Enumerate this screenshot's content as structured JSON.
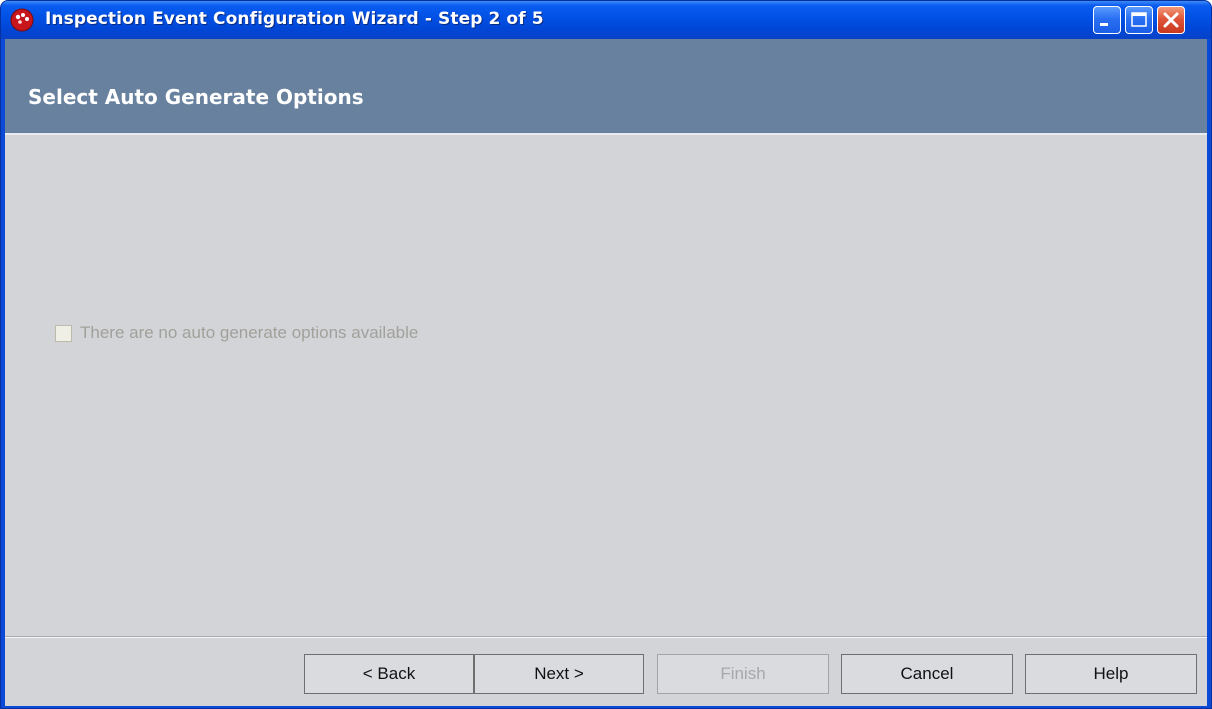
{
  "window": {
    "title": "Inspection Event Configuration Wizard - Step 2 of 5"
  },
  "header": {
    "title": "Select Auto Generate Options"
  },
  "options": {
    "checkbox_label": "There are no auto generate options available",
    "checked": false,
    "enabled": false
  },
  "buttons": {
    "back": "< Back",
    "next": "Next >",
    "finish": "Finish",
    "cancel": "Cancel",
    "help": "Help"
  },
  "icons": {
    "app": "app-icon",
    "minimize": "minimize-icon",
    "maximize": "maximize-icon",
    "close": "close-icon"
  },
  "colors": {
    "titlebar": "#0252e6",
    "header_bg": "#67819f",
    "client_bg": "#d2d4d8",
    "close_button": "#e0553a"
  }
}
